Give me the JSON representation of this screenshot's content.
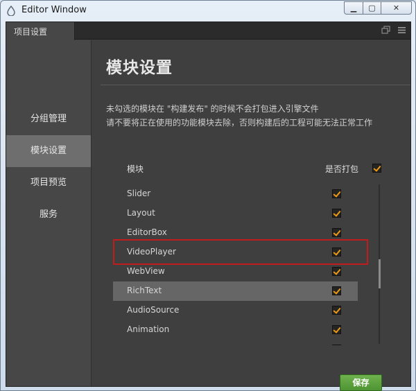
{
  "window": {
    "title": "Editor Window",
    "minimize_glyph": "▁",
    "maximize_glyph": "▢",
    "close_glyph": "✕"
  },
  "tab": {
    "label": "项目设置"
  },
  "sidebar": {
    "items": [
      {
        "label": "分组管理",
        "active": false
      },
      {
        "label": "模块设置",
        "active": true
      },
      {
        "label": "项目预览",
        "active": false
      },
      {
        "label": "服务",
        "active": false
      }
    ]
  },
  "main": {
    "title": "模块设置",
    "description_line1": "未勾选的模块在 \"构建发布\" 的时候不会打包进入引擎文件",
    "description_line2": "请不要将正在使用的功能模块去除，否则构建后的工程可能无法正常工作",
    "header_module": "模块",
    "header_pack": "是否打包",
    "header_pack_checked": true,
    "modules": [
      {
        "name": "Slider",
        "checked": true
      },
      {
        "name": "Layout",
        "checked": true
      },
      {
        "name": "EditorBox",
        "checked": true
      },
      {
        "name": "VideoPlayer",
        "checked": true
      },
      {
        "name": "WebView",
        "checked": true
      },
      {
        "name": "RichText",
        "checked": true,
        "selected": true
      },
      {
        "name": "AudioSource",
        "checked": true
      },
      {
        "name": "Animation",
        "checked": true
      }
    ],
    "save_label": "保存"
  },
  "colors": {
    "accent_check": "#f09a14",
    "highlight_border": "#c01c1c",
    "save_button": "#5aa23c",
    "panel_bg": "#3f3f3f",
    "sidebar_active": "#6e6e6e"
  }
}
